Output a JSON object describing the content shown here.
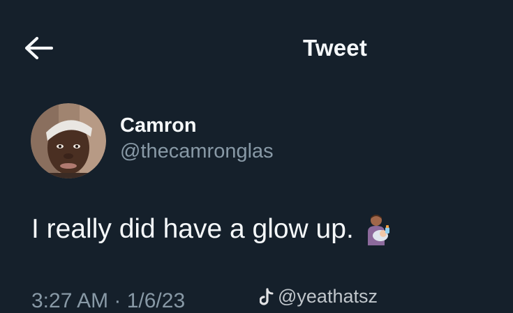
{
  "header": {
    "title": "Tweet",
    "back_icon": "arrow-left-icon"
  },
  "author": {
    "display_name": "Camron",
    "handle": "@thecamronglas"
  },
  "tweet": {
    "text": "I really did have a glow up.",
    "emoji": "person-feeding-baby-emoji"
  },
  "meta": {
    "timestamp": "3:27 AM · 1/6/23"
  },
  "watermark": {
    "logo": "tiktok-logo-icon",
    "text": "@yeathatsz"
  },
  "colors": {
    "background": "#15202b",
    "primary_text": "#f5f8fa",
    "secondary_text": "#8899a6"
  }
}
